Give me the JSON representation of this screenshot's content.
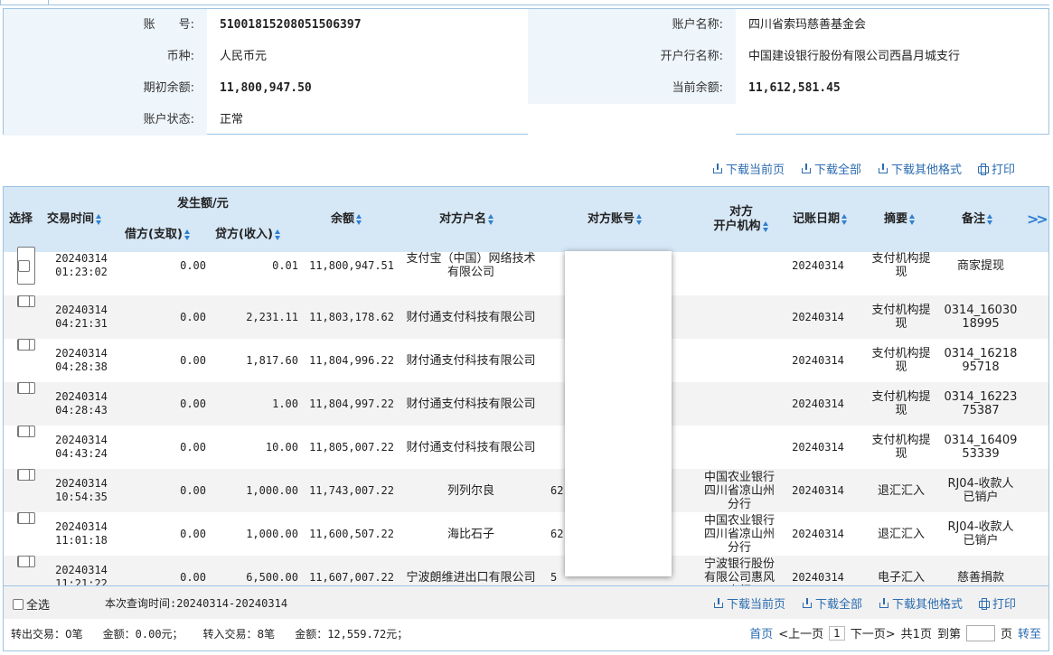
{
  "account": {
    "acct_no_label": "账　　号:",
    "acct_no": "51001815208051506397",
    "acct_name_label": "账户名称:",
    "acct_name": "四川省索玛慈善基金会",
    "currency_label": "币种:",
    "currency": "人民币元",
    "bank_label": "开户行名称:",
    "bank": "中国建设银行股份有限公司西昌月城支行",
    "open_bal_label": "期初余额:",
    "open_bal": "11,800,947.50",
    "cur_bal_label": "当前余额:",
    "cur_bal": "11,612,581.45",
    "status_label": "账户状态:",
    "status": "正常"
  },
  "actions": {
    "download_page": "下载当前页",
    "download_all": "下载全部",
    "download_other": "下载其他格式",
    "print": "打印"
  },
  "table": {
    "headers": {
      "select": "选择",
      "time": "交易时间",
      "amount_group": "发生额/元",
      "debit": "借方(支取)",
      "credit": "贷方(收入)",
      "balance": "余额",
      "cp_name": "对方户名",
      "cp_acct": "对方账号",
      "cp_bank_1": "对方",
      "cp_bank_2": "开户机构",
      "book_date": "记账日期",
      "summary": "摘要",
      "remark": "备注",
      "more_icon": "double-chevron-right"
    },
    "rows": [
      {
        "date": "20240314",
        "time": "01:23:02",
        "debit": "0.00",
        "credit": "0.01",
        "balance": "11,800,947.51",
        "cp_name": "支付宝（中国）网络技术有限公司",
        "cp_acct": "",
        "cp_bank": "",
        "book_date": "20240314",
        "summary": "支付机构提现",
        "remark": "商家提现"
      },
      {
        "date": "20240314",
        "time": "04:21:31",
        "debit": "0.00",
        "credit": "2,231.11",
        "balance": "11,803,178.62",
        "cp_name": "财付通支付科技有限公司",
        "cp_acct": "",
        "cp_bank": "",
        "book_date": "20240314",
        "summary": "支付机构提现",
        "remark": "0314_1603018995"
      },
      {
        "date": "20240314",
        "time": "04:28:38",
        "debit": "0.00",
        "credit": "1,817.60",
        "balance": "11,804,996.22",
        "cp_name": "财付通支付科技有限公司",
        "cp_acct": "",
        "cp_bank": "",
        "book_date": "20240314",
        "summary": "支付机构提现",
        "remark": "0314_1621895718"
      },
      {
        "date": "20240314",
        "time": "04:28:43",
        "debit": "0.00",
        "credit": "1.00",
        "balance": "11,804,997.22",
        "cp_name": "财付通支付科技有限公司",
        "cp_acct": "",
        "cp_bank": "",
        "book_date": "20240314",
        "summary": "支付机构提现",
        "remark": "0314_1622375387"
      },
      {
        "date": "20240314",
        "time": "04:43:24",
        "debit": "0.00",
        "credit": "10.00",
        "balance": "11,805,007.22",
        "cp_name": "财付通支付科技有限公司",
        "cp_acct": "",
        "cp_bank": "",
        "book_date": "20240314",
        "summary": "支付机构提现",
        "remark": "0314_1640953339"
      },
      {
        "date": "20240314",
        "time": "10:54:35",
        "debit": "0.00",
        "credit": "1,000.00",
        "balance": "11,743,007.22",
        "cp_name": "列列尔良",
        "cp_acct": "62",
        "cp_bank": "中国农业银行四川省凉山州分行",
        "book_date": "20240314",
        "summary": "退汇汇入",
        "remark": "RJ04-收款人已销户"
      },
      {
        "date": "20240314",
        "time": "11:01:18",
        "debit": "0.00",
        "credit": "1,000.00",
        "balance": "11,600,507.22",
        "cp_name": "海比石子",
        "cp_acct": "62",
        "cp_bank": "中国农业银行四川省凉山州分行",
        "book_date": "20240314",
        "summary": "退汇汇入",
        "remark": "RJ04-收款人已销户"
      },
      {
        "date": "20240314",
        "time": "11:21:22",
        "debit": "0.00",
        "credit": "6,500.00",
        "balance": "11,607,007.22",
        "cp_name": "宁波朗维进出口有限公司",
        "cp_acct": "5",
        "cp_bank": "宁波银行股份有限公司惠风支行",
        "book_date": "20240314",
        "summary": "电子汇入",
        "remark": "慈善捐款"
      }
    ]
  },
  "footer": {
    "select_all": "全选",
    "query_time": "本次查询时间:20240314-20240314",
    "out_count": "转出交易：0笔",
    "out_amount": "金额：0.00元；",
    "in_count": "转入交易：8笔",
    "in_amount": "金额：12,559.72元；",
    "first": "首页",
    "prev": "<上一页",
    "page": "1",
    "next": "下一页>",
    "total": "共1页",
    "goto_pre": "到第",
    "goto_post": "页",
    "goto": "转至"
  }
}
